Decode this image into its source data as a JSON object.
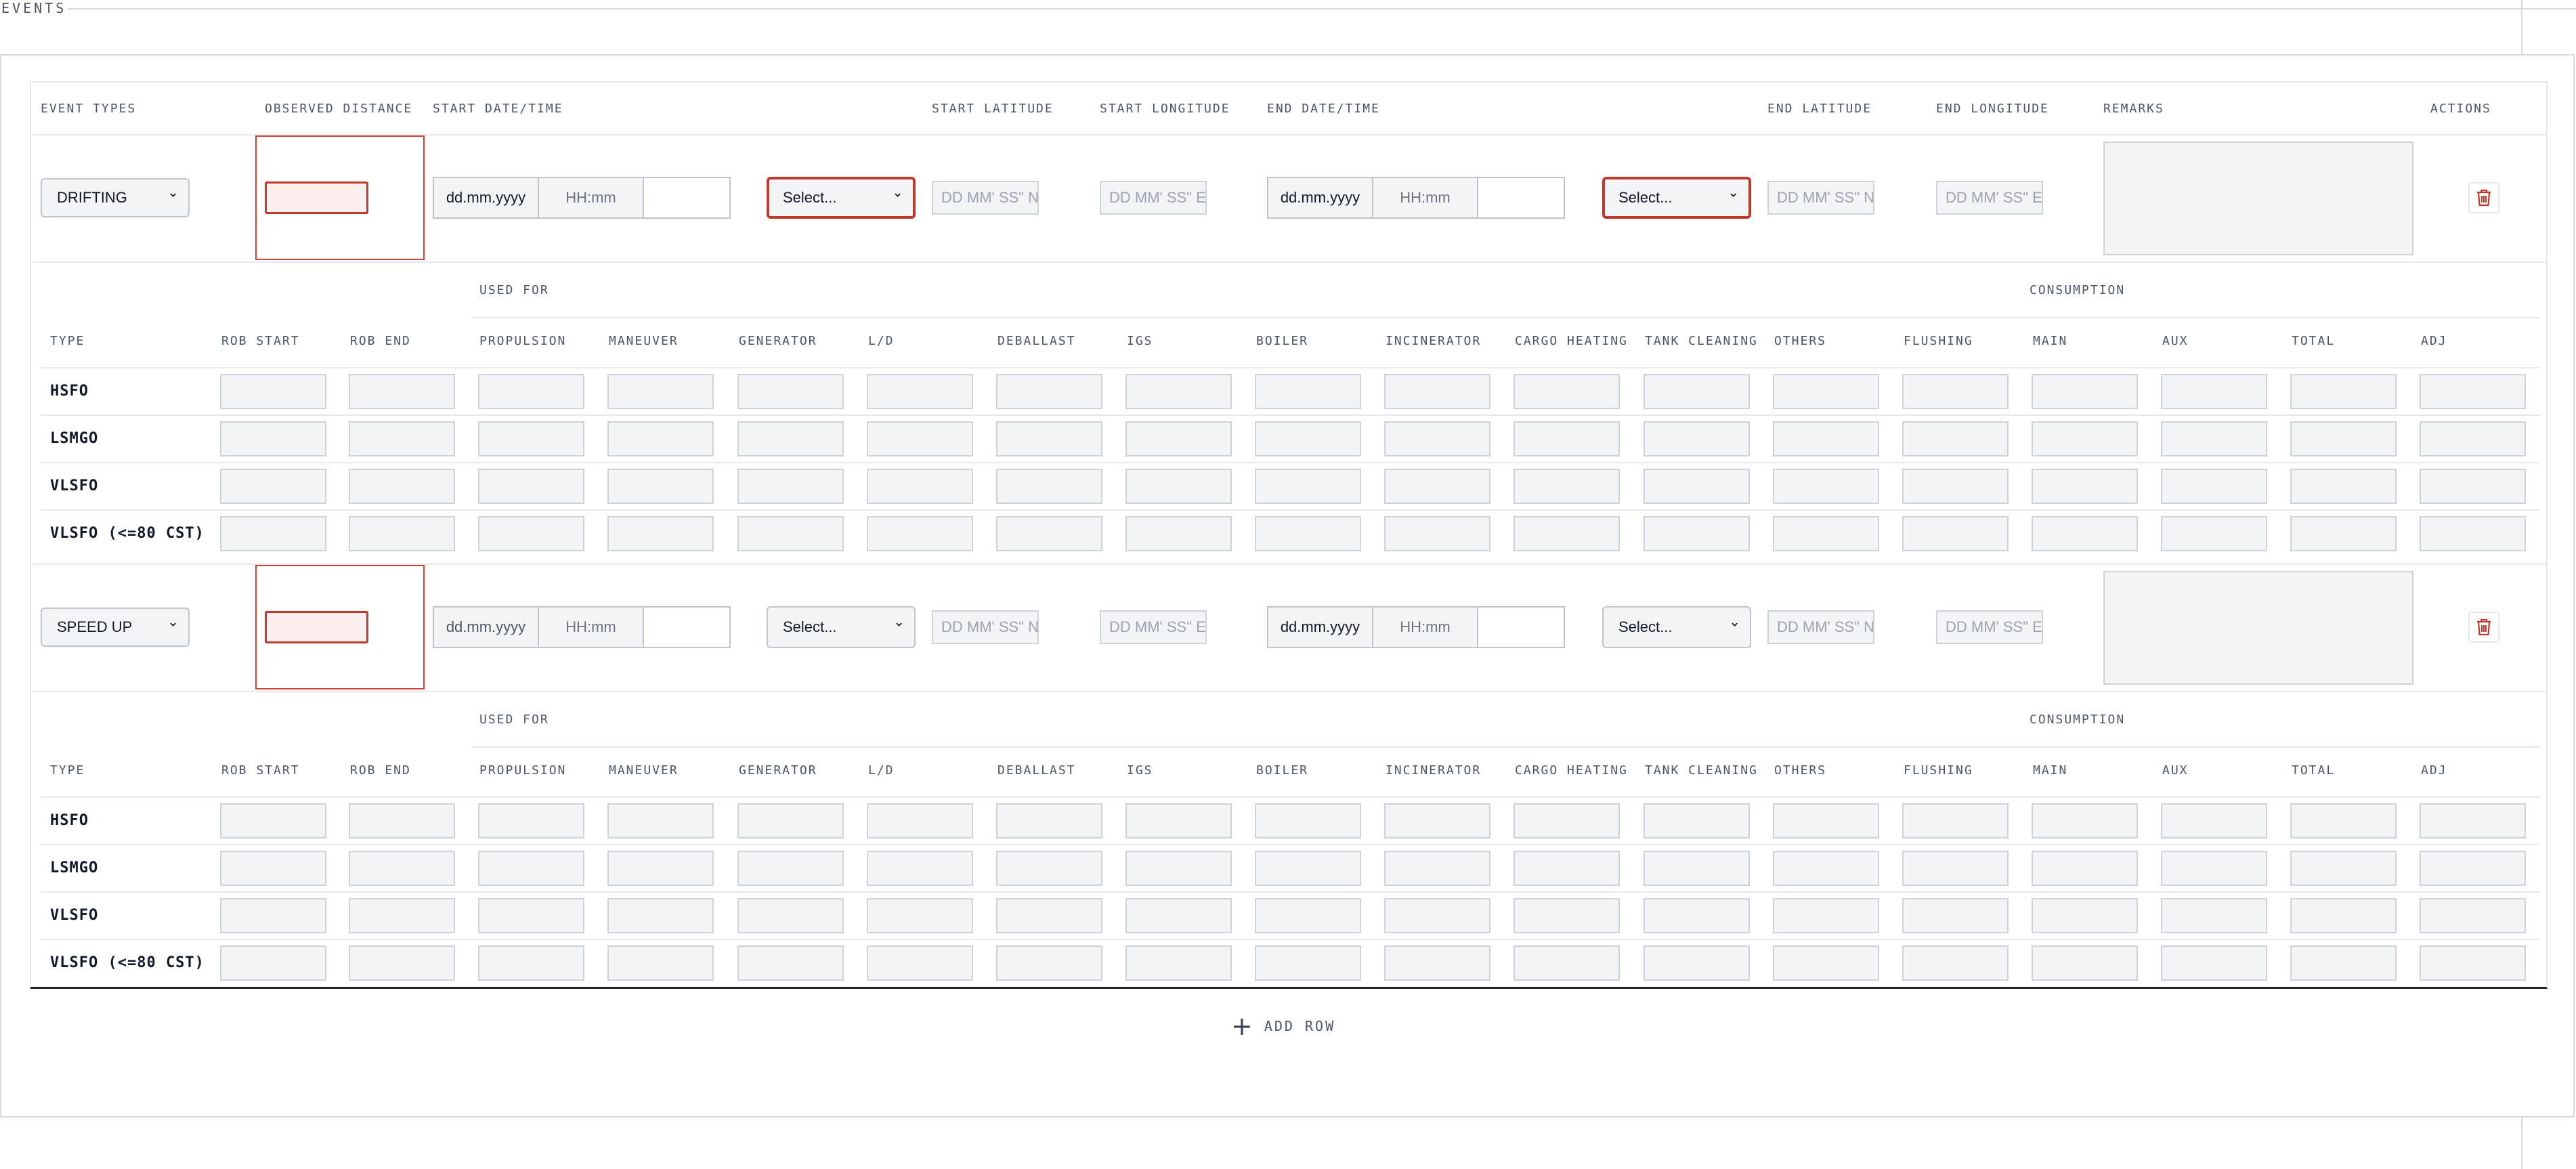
{
  "section": {
    "title": "EVENTS"
  },
  "columns": [
    "EVENT TYPES",
    "OBSERVED DISTANCE",
    "START DATE/TIME",
    "START LATITUDE",
    "START LONGITUDE",
    "END DATE/TIME",
    "END LATITUDE",
    "END LONGITUDE",
    "REMARKS",
    "ACTIONS"
  ],
  "events": [
    {
      "type": "DRIFTING",
      "start_date": "dd.mm.yyyy",
      "start_time": "HH:mm",
      "start_tz": "Select...",
      "lat_placeholder": "DD MM' SS\" N",
      "lon_placeholder": "DD MM' SS\" E",
      "end_date": "dd.mm.yyyy",
      "end_time": "HH:mm",
      "end_tz": "Select..."
    },
    {
      "type": "SPEED UP",
      "start_date": "dd.mm.yyyy",
      "start_time": "HH:mm",
      "start_tz": "Select...",
      "lat_placeholder": "DD MM' SS\" N",
      "lon_placeholder": "DD MM' SS\" E",
      "end_date": "dd.mm.yyyy",
      "end_time": "HH:mm",
      "end_tz": "Select..."
    }
  ],
  "consumption": {
    "group_used_for": "USED FOR",
    "group_consumption": "CONSUMPTION",
    "headers": [
      "TYPE",
      "ROB START",
      "ROB END",
      "PROPULSION",
      "MANEUVER",
      "GENERATOR",
      "L/D",
      "DEBALLAST",
      "IGS",
      "BOILER",
      "INCINERATOR",
      "CARGO HEATING",
      "TANK CLEANING",
      "OTHERS",
      "FLUSHING",
      "MAIN",
      "AUX",
      "TOTAL",
      "ADJ"
    ],
    "fuels": [
      "HSFO",
      "LSMGO",
      "VLSFO",
      "VLSFO (<=80 CST)"
    ]
  },
  "add_row_label": "ADD ROW",
  "colors": {
    "error": "#c0392b",
    "border": "#cfd3d9",
    "field_bg": "#f3f4f6"
  },
  "icons": {
    "delete": "trash-icon",
    "add": "plus-icon",
    "dropdown": "chevron-down-icon"
  }
}
